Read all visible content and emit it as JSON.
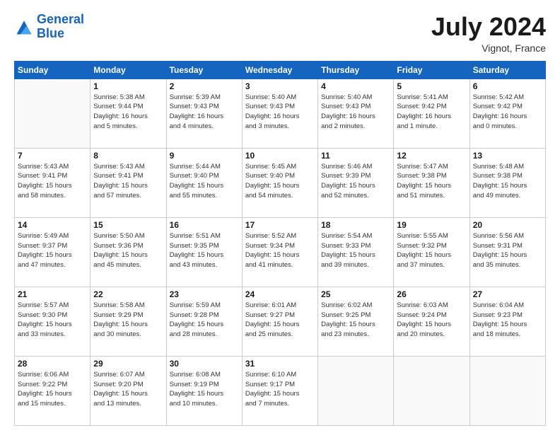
{
  "header": {
    "logo_line1": "General",
    "logo_line2": "Blue",
    "month": "July 2024",
    "location": "Vignot, France"
  },
  "weekdays": [
    "Sunday",
    "Monday",
    "Tuesday",
    "Wednesday",
    "Thursday",
    "Friday",
    "Saturday"
  ],
  "weeks": [
    [
      {
        "day": "",
        "info": ""
      },
      {
        "day": "1",
        "info": "Sunrise: 5:38 AM\nSunset: 9:44 PM\nDaylight: 16 hours\nand 5 minutes."
      },
      {
        "day": "2",
        "info": "Sunrise: 5:39 AM\nSunset: 9:43 PM\nDaylight: 16 hours\nand 4 minutes."
      },
      {
        "day": "3",
        "info": "Sunrise: 5:40 AM\nSunset: 9:43 PM\nDaylight: 16 hours\nand 3 minutes."
      },
      {
        "day": "4",
        "info": "Sunrise: 5:40 AM\nSunset: 9:43 PM\nDaylight: 16 hours\nand 2 minutes."
      },
      {
        "day": "5",
        "info": "Sunrise: 5:41 AM\nSunset: 9:42 PM\nDaylight: 16 hours\nand 1 minute."
      },
      {
        "day": "6",
        "info": "Sunrise: 5:42 AM\nSunset: 9:42 PM\nDaylight: 16 hours\nand 0 minutes."
      }
    ],
    [
      {
        "day": "7",
        "info": "Sunrise: 5:43 AM\nSunset: 9:41 PM\nDaylight: 15 hours\nand 58 minutes."
      },
      {
        "day": "8",
        "info": "Sunrise: 5:43 AM\nSunset: 9:41 PM\nDaylight: 15 hours\nand 57 minutes."
      },
      {
        "day": "9",
        "info": "Sunrise: 5:44 AM\nSunset: 9:40 PM\nDaylight: 15 hours\nand 55 minutes."
      },
      {
        "day": "10",
        "info": "Sunrise: 5:45 AM\nSunset: 9:40 PM\nDaylight: 15 hours\nand 54 minutes."
      },
      {
        "day": "11",
        "info": "Sunrise: 5:46 AM\nSunset: 9:39 PM\nDaylight: 15 hours\nand 52 minutes."
      },
      {
        "day": "12",
        "info": "Sunrise: 5:47 AM\nSunset: 9:38 PM\nDaylight: 15 hours\nand 51 minutes."
      },
      {
        "day": "13",
        "info": "Sunrise: 5:48 AM\nSunset: 9:38 PM\nDaylight: 15 hours\nand 49 minutes."
      }
    ],
    [
      {
        "day": "14",
        "info": "Sunrise: 5:49 AM\nSunset: 9:37 PM\nDaylight: 15 hours\nand 47 minutes."
      },
      {
        "day": "15",
        "info": "Sunrise: 5:50 AM\nSunset: 9:36 PM\nDaylight: 15 hours\nand 45 minutes."
      },
      {
        "day": "16",
        "info": "Sunrise: 5:51 AM\nSunset: 9:35 PM\nDaylight: 15 hours\nand 43 minutes."
      },
      {
        "day": "17",
        "info": "Sunrise: 5:52 AM\nSunset: 9:34 PM\nDaylight: 15 hours\nand 41 minutes."
      },
      {
        "day": "18",
        "info": "Sunrise: 5:54 AM\nSunset: 9:33 PM\nDaylight: 15 hours\nand 39 minutes."
      },
      {
        "day": "19",
        "info": "Sunrise: 5:55 AM\nSunset: 9:32 PM\nDaylight: 15 hours\nand 37 minutes."
      },
      {
        "day": "20",
        "info": "Sunrise: 5:56 AM\nSunset: 9:31 PM\nDaylight: 15 hours\nand 35 minutes."
      }
    ],
    [
      {
        "day": "21",
        "info": "Sunrise: 5:57 AM\nSunset: 9:30 PM\nDaylight: 15 hours\nand 33 minutes."
      },
      {
        "day": "22",
        "info": "Sunrise: 5:58 AM\nSunset: 9:29 PM\nDaylight: 15 hours\nand 30 minutes."
      },
      {
        "day": "23",
        "info": "Sunrise: 5:59 AM\nSunset: 9:28 PM\nDaylight: 15 hours\nand 28 minutes."
      },
      {
        "day": "24",
        "info": "Sunrise: 6:01 AM\nSunset: 9:27 PM\nDaylight: 15 hours\nand 25 minutes."
      },
      {
        "day": "25",
        "info": "Sunrise: 6:02 AM\nSunset: 9:25 PM\nDaylight: 15 hours\nand 23 minutes."
      },
      {
        "day": "26",
        "info": "Sunrise: 6:03 AM\nSunset: 9:24 PM\nDaylight: 15 hours\nand 20 minutes."
      },
      {
        "day": "27",
        "info": "Sunrise: 6:04 AM\nSunset: 9:23 PM\nDaylight: 15 hours\nand 18 minutes."
      }
    ],
    [
      {
        "day": "28",
        "info": "Sunrise: 6:06 AM\nSunset: 9:22 PM\nDaylight: 15 hours\nand 15 minutes."
      },
      {
        "day": "29",
        "info": "Sunrise: 6:07 AM\nSunset: 9:20 PM\nDaylight: 15 hours\nand 13 minutes."
      },
      {
        "day": "30",
        "info": "Sunrise: 6:08 AM\nSunset: 9:19 PM\nDaylight: 15 hours\nand 10 minutes."
      },
      {
        "day": "31",
        "info": "Sunrise: 6:10 AM\nSunset: 9:17 PM\nDaylight: 15 hours\nand 7 minutes."
      },
      {
        "day": "",
        "info": ""
      },
      {
        "day": "",
        "info": ""
      },
      {
        "day": "",
        "info": ""
      }
    ]
  ]
}
